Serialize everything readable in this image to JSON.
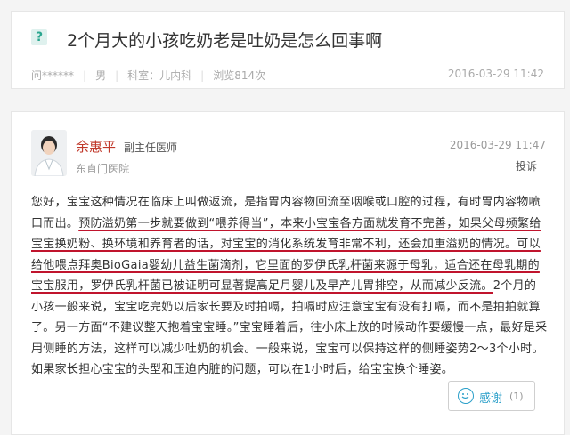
{
  "question": {
    "icon": "?",
    "title": "2个月大的小孩吃奶老是吐奶是怎么回事啊",
    "author": "问******",
    "gender": "男",
    "department": "科室：儿内科",
    "views": "浏览814次",
    "date": "2016-03-29 11:42"
  },
  "answer": {
    "doctor_name": "余惠平",
    "doctor_title": "副主任医师",
    "hospital": "东直门医院",
    "date": "2016-03-29 11:47",
    "report_label": "投诉",
    "text": {
      "p1": "您好，宝宝这种情况在临床上叫做返流，是指胃内容物回流至咽喉或口腔的过程，有时胃内容物喷口而出。",
      "h1": "预防溢奶第一步就要做到“喂养得当”，本来小宝宝各方面就发育不完善，如果父母频繁给宝宝换奶粉、换环境和养育者的话，对宝宝的消化系统发育非常不利，还会加重溢奶的情况。可以给他喂点拜奥BioGaia婴幼儿益生菌滴剂，它里面的罗伊氏乳杆菌来源于母乳，适合还在母乳期的宝宝服用，罗伊氏乳杆菌已被证明可显著提高足月婴儿及早产儿胃排空，从而减少反流。",
      "p2": "2个月的小孩一般来说，宝宝吃完奶以后家长要及时拍嗝，拍嗝时应注意宝宝有没有打嗝，而不是拍拍就算了。另一方面“不建议整天抱着宝宝睡。”宝宝睡着后，往小床上放的时候动作要缓慢一点，最好是采用侧睡的方法，这样可以减少吐奶的机会。一般来说，宝宝可以保持这样的侧睡姿势2～3个小时。如果家长担心宝宝的头型和压迫内脏的问题，可以在1小时后，给宝宝换个睡姿。"
    },
    "thanks_label": "感谢",
    "thanks_count": "(1)"
  },
  "colors": {
    "accent": "#2aa68f",
    "doctor_name": "#c0392b",
    "underline": "#c0142d",
    "thanks": "#2a9fc9"
  }
}
